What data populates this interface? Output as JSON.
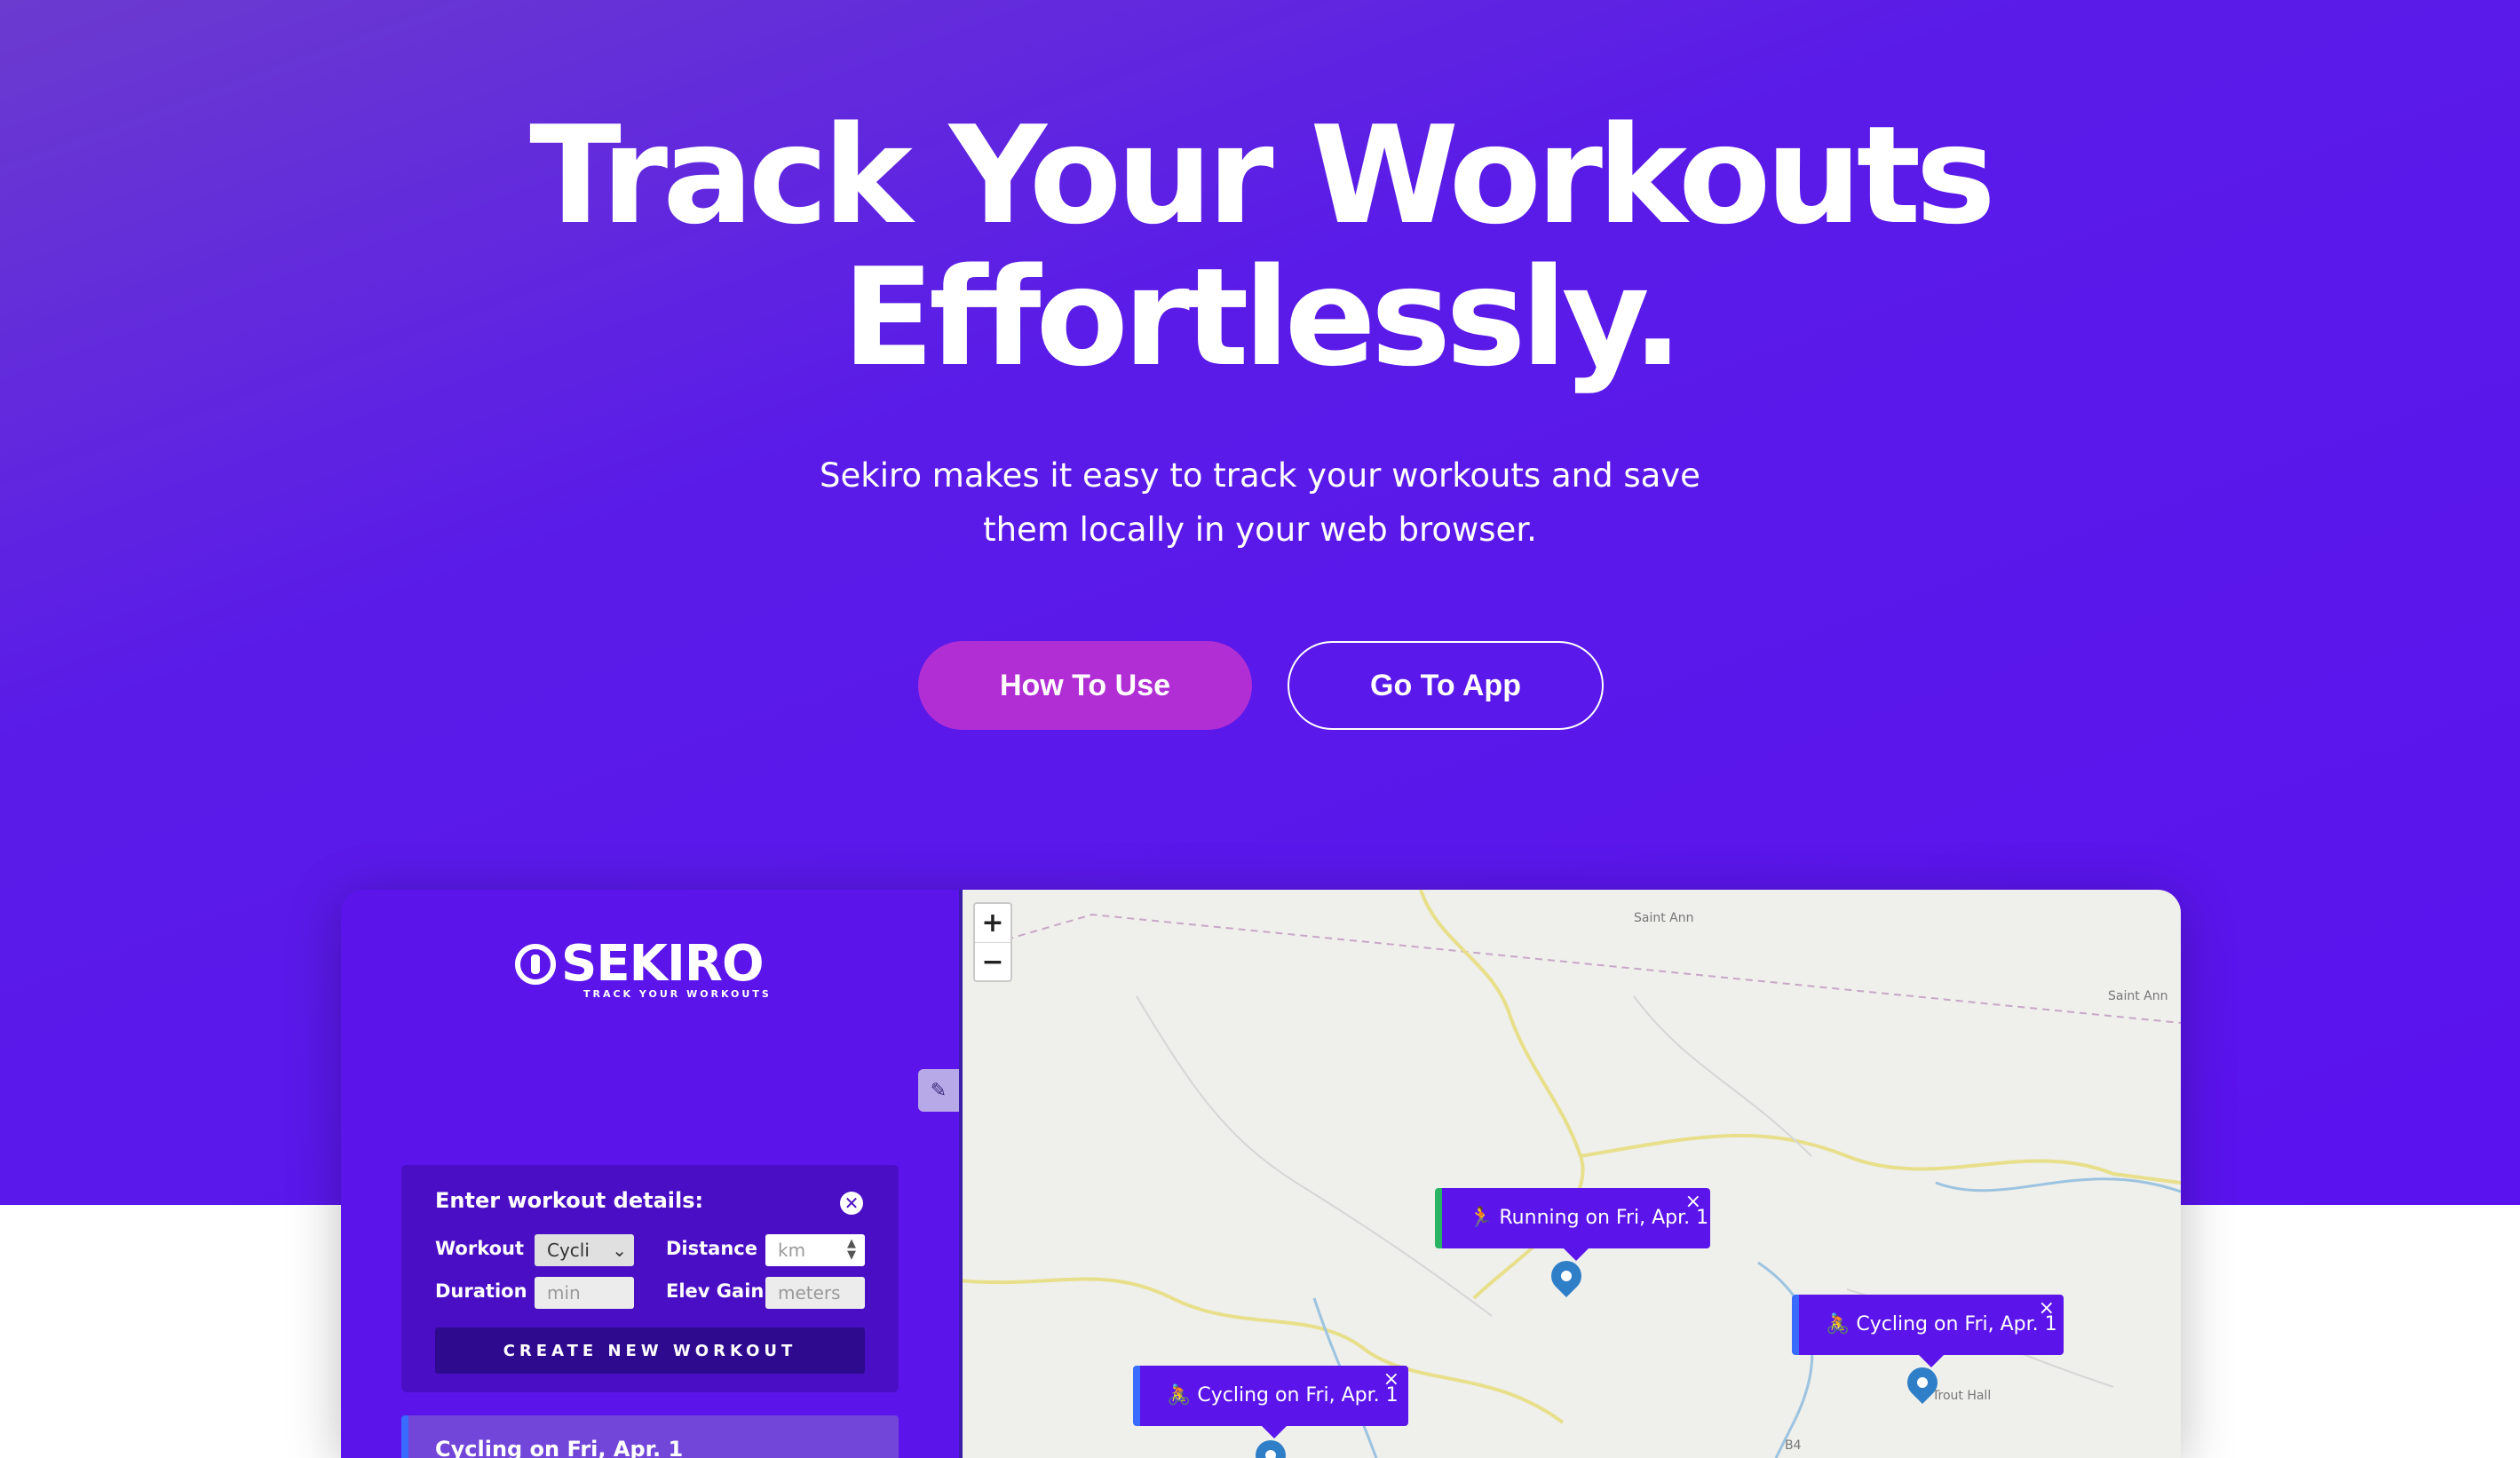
{
  "hero": {
    "title_line1": "Track Your Workouts",
    "title_line2": "Effortlessly.",
    "subtitle_line1": "Sekiro makes it easy to track your workouts and save",
    "subtitle_line2": "them locally in your web browser."
  },
  "buttons": {
    "how_to_use": "How To Use",
    "go_to_app": "Go To App"
  },
  "app": {
    "logo_text": "SEKIRO",
    "logo_tagline": "TRACK YOUR WORKOUTS",
    "toggle_icon": "brush-icon",
    "form": {
      "title": "Enter workout details:",
      "close_glyph": "✕",
      "workout_label": "Workout",
      "workout_value": "Cycli",
      "distance_label": "Distance",
      "distance_placeholder": "km",
      "duration_label": "Duration",
      "duration_placeholder": "min",
      "elev_label": "Elev Gain",
      "elev_placeholder": "meters",
      "create_label": "CREATE NEW WORKOUT"
    },
    "list": [
      {
        "title": "Cycling on Fri, Apr. 1"
      }
    ],
    "map": {
      "zoom_in": "+",
      "zoom_out": "−",
      "labels": [
        "Saint Ann",
        "Saint Ann",
        "Trout Hall",
        "B4"
      ],
      "popups": [
        {
          "text": "🏃 Running on Fri, Apr. 1",
          "type": "running"
        },
        {
          "text": "🚴 Cycling on Fri, Apr. 1",
          "type": "cycling"
        },
        {
          "text": "🚴 Cycling on Fri, Apr. 1",
          "type": "cycling"
        }
      ],
      "close_glyph": "×"
    }
  },
  "colors": {
    "hero_bg": "#5a12ee",
    "primary_button": "#b12ed4",
    "panel_bg": "#5b14ea",
    "running_accent": "#28b463",
    "cycling_accent": "#3a6bff"
  }
}
